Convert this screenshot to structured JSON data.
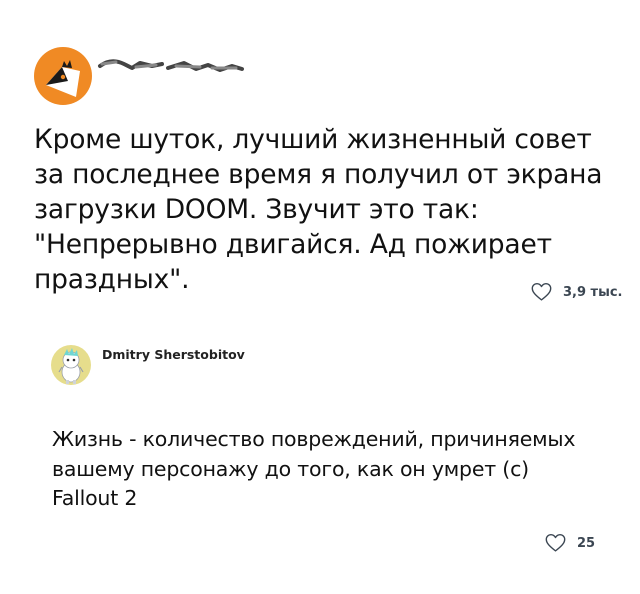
{
  "post": {
    "text": "Кроме шуток, лучший жизненный совет за последнее время я получил от экрана загрузки DOOM. Звучит это так: \"Непрерывно двигайся. Ад пожирает праздных\".",
    "likes": "3,9 тыс.",
    "like_icon": "heart-outline-icon",
    "avatar_color": "#f08a24"
  },
  "reply": {
    "author": "Dmitry Sherstobitov",
    "text": "Жизнь - количество повреждений, причиняемых вашему персонажу до того, как он умрет (с) Fallout 2",
    "likes": "25",
    "like_icon": "heart-outline-icon",
    "avatar_color": "#e6dd8c"
  }
}
